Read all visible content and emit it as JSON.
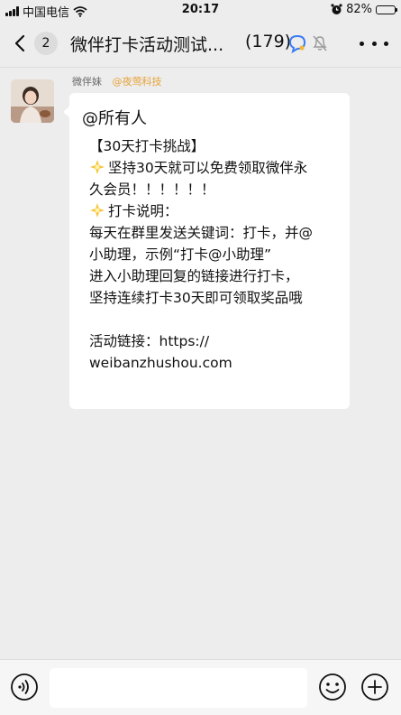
{
  "status_bar": {
    "carrier": "中国电信",
    "time": "20:17",
    "battery": "82%",
    "battery_level": 0.82,
    "icons": [
      "signal-icon",
      "wifi-icon",
      "alarm-icon",
      "battery-icon"
    ]
  },
  "nav": {
    "unread_count": "2",
    "title": "微伴打卡活动测试...",
    "member_count": "(179)",
    "icons": [
      "back-chevron-icon",
      "chat-search-icon",
      "mute-bell-icon",
      "more-icon"
    ]
  },
  "message": {
    "sender_name": "微伴妹",
    "sender_org": "@夜莺科技",
    "mention": "@所有人",
    "lines": [
      "【30天打卡挑战】",
      "坚持30天就可以免费领取微伴永",
      "久会员！！！！！！",
      "打卡说明：",
      "每天在群里发送关键词：打卡，并@",
      "小助理，示例“打卡@小助理”",
      "进入小助理回复的链接进行打卡，",
      "坚持连续打卡30天即可领取奖品哦",
      "活动链接：https://",
      "weibanzhushou.com"
    ]
  },
  "input_bar": {
    "placeholder": "",
    "icons": [
      "voice-icon",
      "emoji-icon",
      "plus-icon"
    ]
  },
  "colors": {
    "background": "#ededed",
    "bubble": "#ffffff",
    "org_tag": "#e8a33a",
    "battery_fill": "#2bbf4a",
    "accent_blue": "#3b7cf5"
  }
}
